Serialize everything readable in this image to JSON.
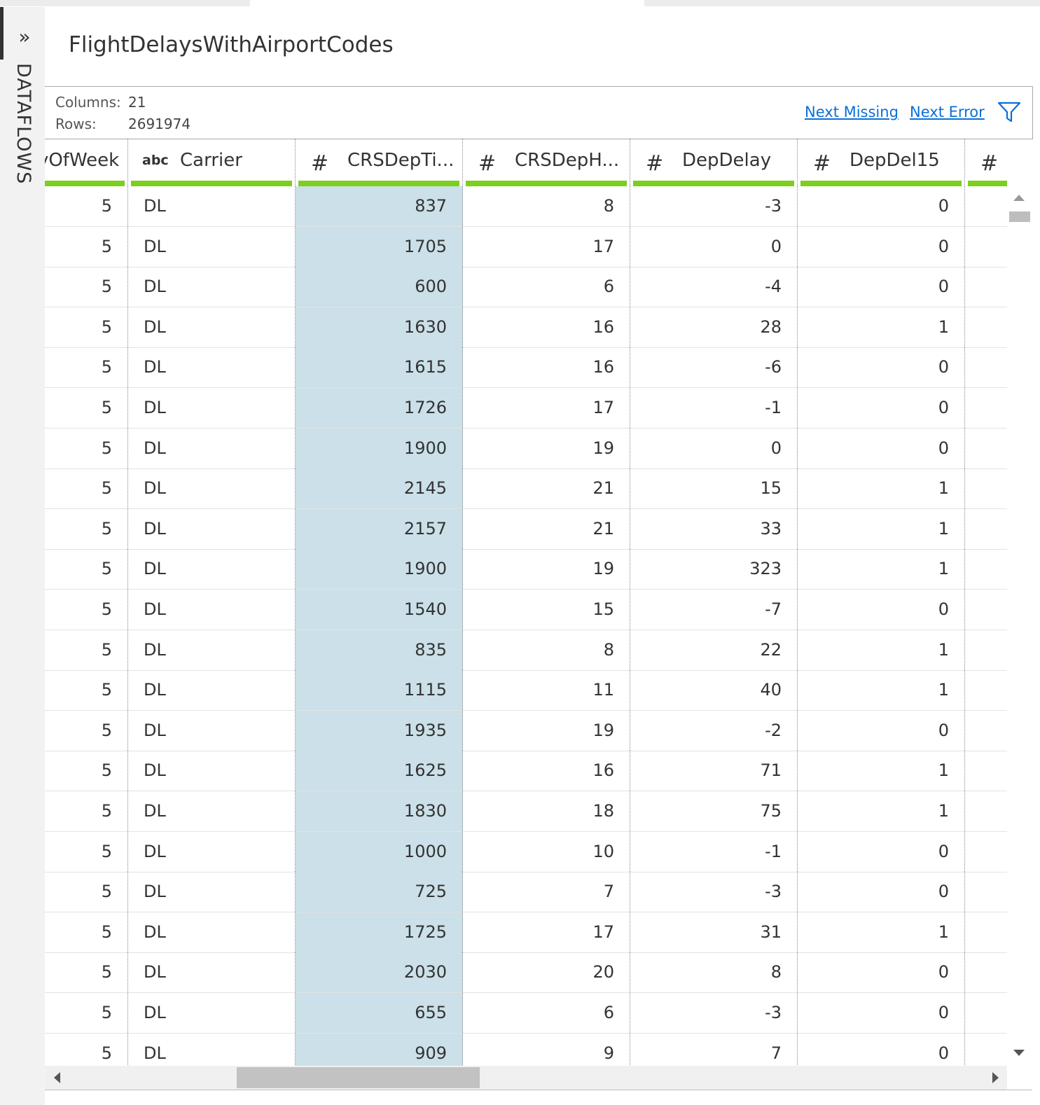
{
  "side_panel": {
    "label": "DATAFLOWS",
    "toggle_icon": "double-chevron-right-icon"
  },
  "title": "FlightDelaysWithAirportCodes",
  "info": {
    "columns_label": "Columns:",
    "columns_value": "21",
    "rows_label": "Rows:",
    "rows_value": "2691974"
  },
  "links": {
    "next_missing": "Next Missing",
    "next_error": "Next Error"
  },
  "filter_icon": "filter-icon",
  "colors": {
    "quality_bar": "#7ccf1c",
    "selected_column": "#cbe0e8",
    "link": "#0a6fd8"
  },
  "columns": [
    {
      "name": "DayOfWeek",
      "type": "#"
    },
    {
      "name": "Carrier",
      "type": "abc"
    },
    {
      "name": "CRSDepTi...",
      "type": "#",
      "selected": true
    },
    {
      "name": "CRSDepH...",
      "type": "#"
    },
    {
      "name": "DepDelay",
      "type": "#"
    },
    {
      "name": "DepDel15",
      "type": "#"
    },
    {
      "name": "",
      "type": "#"
    }
  ],
  "rows": [
    [
      "5",
      "DL",
      "837",
      "8",
      "-3",
      "0"
    ],
    [
      "5",
      "DL",
      "1705",
      "17",
      "0",
      "0"
    ],
    [
      "5",
      "DL",
      "600",
      "6",
      "-4",
      "0"
    ],
    [
      "5",
      "DL",
      "1630",
      "16",
      "28",
      "1"
    ],
    [
      "5",
      "DL",
      "1615",
      "16",
      "-6",
      "0"
    ],
    [
      "5",
      "DL",
      "1726",
      "17",
      "-1",
      "0"
    ],
    [
      "5",
      "DL",
      "1900",
      "19",
      "0",
      "0"
    ],
    [
      "5",
      "DL",
      "2145",
      "21",
      "15",
      "1"
    ],
    [
      "5",
      "DL",
      "2157",
      "21",
      "33",
      "1"
    ],
    [
      "5",
      "DL",
      "1900",
      "19",
      "323",
      "1"
    ],
    [
      "5",
      "DL",
      "1540",
      "15",
      "-7",
      "0"
    ],
    [
      "5",
      "DL",
      "835",
      "8",
      "22",
      "1"
    ],
    [
      "5",
      "DL",
      "1115",
      "11",
      "40",
      "1"
    ],
    [
      "5",
      "DL",
      "1935",
      "19",
      "-2",
      "0"
    ],
    [
      "5",
      "DL",
      "1625",
      "16",
      "71",
      "1"
    ],
    [
      "5",
      "DL",
      "1830",
      "18",
      "75",
      "1"
    ],
    [
      "5",
      "DL",
      "1000",
      "10",
      "-1",
      "0"
    ],
    [
      "5",
      "DL",
      "725",
      "7",
      "-3",
      "0"
    ],
    [
      "5",
      "DL",
      "1725",
      "17",
      "31",
      "1"
    ],
    [
      "5",
      "DL",
      "2030",
      "20",
      "8",
      "0"
    ],
    [
      "5",
      "DL",
      "655",
      "6",
      "-3",
      "0"
    ],
    [
      "5",
      "DL",
      "909",
      "9",
      "7",
      "0"
    ]
  ]
}
